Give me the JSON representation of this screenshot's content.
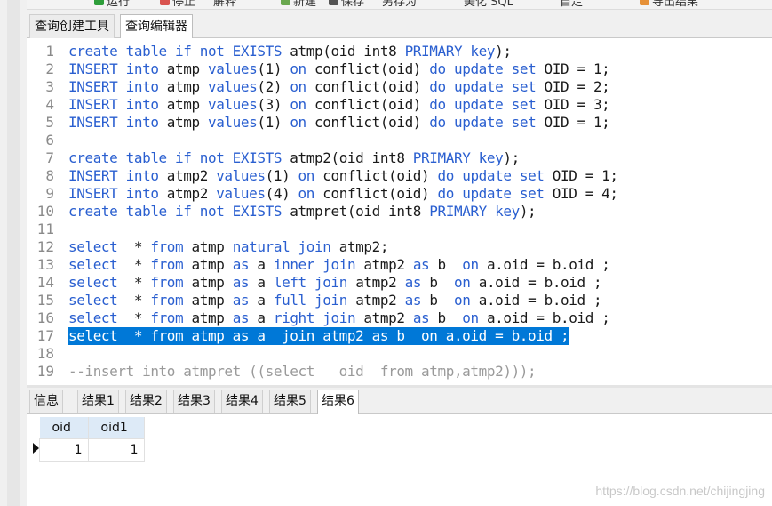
{
  "toolbar": {
    "items": [
      "运行",
      "停止",
      "解释",
      "新建",
      "保存",
      "另存为",
      "美化 SQL",
      "自定",
      "导出结果"
    ]
  },
  "editor_tabs": [
    "查询创建工具",
    "查询编辑器"
  ],
  "editor": {
    "lines": [
      {
        "n": "1",
        "tokens": [
          [
            "kw",
            "create table if not EXISTS "
          ],
          [
            "pl",
            "atmp(oid int8 "
          ],
          [
            "kw",
            "PRIMARY key"
          ],
          [
            "pl",
            ");"
          ]
        ]
      },
      {
        "n": "2",
        "tokens": [
          [
            "kw",
            "INSERT into "
          ],
          [
            "pl",
            "atmp "
          ],
          [
            "kw",
            "values"
          ],
          [
            "pl",
            "(1) "
          ],
          [
            "kw",
            "on "
          ],
          [
            "pl",
            "conflict(oid) "
          ],
          [
            "kw",
            "do update set "
          ],
          [
            "pl",
            "OID = 1;"
          ]
        ]
      },
      {
        "n": "3",
        "tokens": [
          [
            "kw",
            "INSERT into "
          ],
          [
            "pl",
            "atmp "
          ],
          [
            "kw",
            "values"
          ],
          [
            "pl",
            "(2) "
          ],
          [
            "kw",
            "on "
          ],
          [
            "pl",
            "conflict(oid) "
          ],
          [
            "kw",
            "do update set "
          ],
          [
            "pl",
            "OID = 2;"
          ]
        ]
      },
      {
        "n": "4",
        "tokens": [
          [
            "kw",
            "INSERT into "
          ],
          [
            "pl",
            "atmp "
          ],
          [
            "kw",
            "values"
          ],
          [
            "pl",
            "(3) "
          ],
          [
            "kw",
            "on "
          ],
          [
            "pl",
            "conflict(oid) "
          ],
          [
            "kw",
            "do update set "
          ],
          [
            "pl",
            "OID = 3;"
          ]
        ]
      },
      {
        "n": "5",
        "tokens": [
          [
            "kw",
            "INSERT into "
          ],
          [
            "pl",
            "atmp "
          ],
          [
            "kw",
            "values"
          ],
          [
            "pl",
            "(1) "
          ],
          [
            "kw",
            "on "
          ],
          [
            "pl",
            "conflict(oid) "
          ],
          [
            "kw",
            "do update set "
          ],
          [
            "pl",
            "OID = 1;"
          ]
        ]
      },
      {
        "n": "6",
        "tokens": []
      },
      {
        "n": "7",
        "tokens": [
          [
            "kw",
            "create table if not EXISTS "
          ],
          [
            "pl",
            "atmp2(oid int8 "
          ],
          [
            "kw",
            "PRIMARY key"
          ],
          [
            "pl",
            ");"
          ]
        ]
      },
      {
        "n": "8",
        "tokens": [
          [
            "kw",
            "INSERT into "
          ],
          [
            "pl",
            "atmp2 "
          ],
          [
            "kw",
            "values"
          ],
          [
            "pl",
            "(1) "
          ],
          [
            "kw",
            "on "
          ],
          [
            "pl",
            "conflict(oid) "
          ],
          [
            "kw",
            "do update set "
          ],
          [
            "pl",
            "OID = 1;"
          ]
        ]
      },
      {
        "n": "9",
        "tokens": [
          [
            "kw",
            "INSERT into "
          ],
          [
            "pl",
            "atmp2 "
          ],
          [
            "kw",
            "values"
          ],
          [
            "pl",
            "(4) "
          ],
          [
            "kw",
            "on "
          ],
          [
            "pl",
            "conflict(oid) "
          ],
          [
            "kw",
            "do update set "
          ],
          [
            "pl",
            "OID = 4;"
          ]
        ]
      },
      {
        "n": "10",
        "tokens": [
          [
            "kw",
            "create table if not EXISTS "
          ],
          [
            "pl",
            "atmpret(oid int8 "
          ],
          [
            "kw",
            "PRIMARY key"
          ],
          [
            "pl",
            ");"
          ]
        ]
      },
      {
        "n": "11",
        "tokens": []
      },
      {
        "n": "12",
        "tokens": [
          [
            "kw",
            "select  "
          ],
          [
            "pl",
            "* "
          ],
          [
            "kw",
            "from "
          ],
          [
            "pl",
            "atmp "
          ],
          [
            "kw",
            "natural join "
          ],
          [
            "pl",
            "atmp2;"
          ]
        ]
      },
      {
        "n": "13",
        "tokens": [
          [
            "kw",
            "select  "
          ],
          [
            "pl",
            "* "
          ],
          [
            "kw",
            "from "
          ],
          [
            "pl",
            "atmp "
          ],
          [
            "kw",
            "as "
          ],
          [
            "pl",
            "a "
          ],
          [
            "kw",
            "inner join "
          ],
          [
            "pl",
            "atmp2 "
          ],
          [
            "kw",
            "as "
          ],
          [
            "pl",
            "b  "
          ],
          [
            "kw",
            "on "
          ],
          [
            "pl",
            "a.oid = b.oid ;"
          ]
        ]
      },
      {
        "n": "14",
        "tokens": [
          [
            "kw",
            "select  "
          ],
          [
            "pl",
            "* "
          ],
          [
            "kw",
            "from "
          ],
          [
            "pl",
            "atmp "
          ],
          [
            "kw",
            "as "
          ],
          [
            "pl",
            "a "
          ],
          [
            "kw",
            "left join "
          ],
          [
            "pl",
            "atmp2 "
          ],
          [
            "kw",
            "as "
          ],
          [
            "pl",
            "b  "
          ],
          [
            "kw",
            "on "
          ],
          [
            "pl",
            "a.oid = b.oid ;"
          ]
        ]
      },
      {
        "n": "15",
        "tokens": [
          [
            "kw",
            "select  "
          ],
          [
            "pl",
            "* "
          ],
          [
            "kw",
            "from "
          ],
          [
            "pl",
            "atmp "
          ],
          [
            "kw",
            "as "
          ],
          [
            "pl",
            "a "
          ],
          [
            "kw",
            "full join "
          ],
          [
            "pl",
            "atmp2 "
          ],
          [
            "kw",
            "as "
          ],
          [
            "pl",
            "b  "
          ],
          [
            "kw",
            "on "
          ],
          [
            "pl",
            "a.oid = b.oid ;"
          ]
        ]
      },
      {
        "n": "16",
        "tokens": [
          [
            "kw",
            "select  "
          ],
          [
            "pl",
            "* "
          ],
          [
            "kw",
            "from "
          ],
          [
            "pl",
            "atmp "
          ],
          [
            "kw",
            "as "
          ],
          [
            "pl",
            "a "
          ],
          [
            "kw",
            "right join "
          ],
          [
            "pl",
            "atmp2 "
          ],
          [
            "kw",
            "as "
          ],
          [
            "pl",
            "b  "
          ],
          [
            "kw",
            "on "
          ],
          [
            "pl",
            "a.oid = b.oid ;"
          ]
        ]
      },
      {
        "n": "17",
        "selected": true,
        "tokens": [
          [
            "kw",
            "select  * from atmp as a  join atmp2 as b  on a.oid = b.oid ;"
          ]
        ]
      },
      {
        "n": "18",
        "tokens": []
      },
      {
        "n": "19",
        "tokens": [
          [
            "cm",
            "--insert into atmpret ((select   oid  from atmp,atmp2)));"
          ]
        ]
      }
    ]
  },
  "result_tabs": [
    "信息",
    "结果1",
    "结果2",
    "结果3",
    "结果4",
    "结果5",
    "结果6"
  ],
  "result_grid": {
    "columns": [
      "oid",
      "oid1"
    ],
    "rows": [
      [
        "1",
        "1"
      ]
    ]
  },
  "watermark": "https://blog.csdn.net/chijingjing",
  "colors": {
    "keyword": "#2a5fd0",
    "selection": "#0078d7",
    "header": "#ddeaf7"
  }
}
